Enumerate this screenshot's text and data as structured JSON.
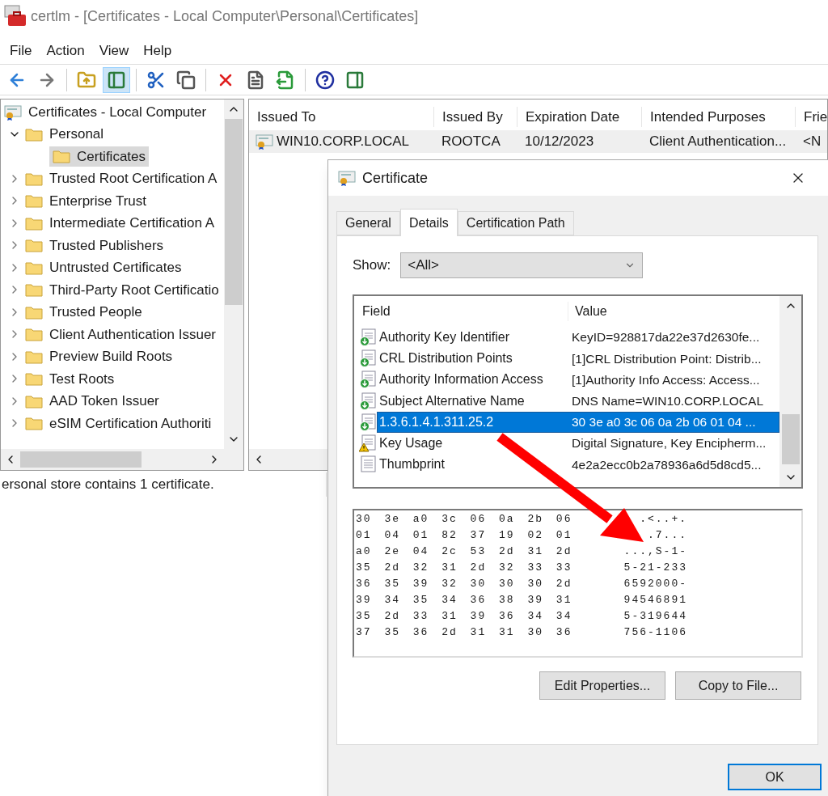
{
  "window": {
    "title": "certlm - [Certificates - Local Computer\\Personal\\Certificates]"
  },
  "menu": [
    "File",
    "Action",
    "View",
    "Help"
  ],
  "toolbar": [
    {
      "kind": "back",
      "selected": false
    },
    {
      "kind": "forward",
      "selected": false
    },
    {
      "kind": "sep"
    },
    {
      "kind": "folder-up",
      "selected": false
    },
    {
      "kind": "tree-pane",
      "selected": true
    },
    {
      "kind": "sep"
    },
    {
      "kind": "cut",
      "selected": false
    },
    {
      "kind": "copy",
      "selected": false
    },
    {
      "kind": "sep"
    },
    {
      "kind": "delete",
      "selected": false
    },
    {
      "kind": "properties",
      "selected": false
    },
    {
      "kind": "export",
      "selected": false
    },
    {
      "kind": "sep"
    },
    {
      "kind": "help",
      "selected": false
    },
    {
      "kind": "action-pane",
      "selected": false
    }
  ],
  "tree": {
    "root": "Certificates - Local Computer",
    "items": [
      {
        "label": "Personal",
        "expanded": true,
        "children": [
          {
            "label": "Certificates",
            "selected": true
          }
        ]
      },
      {
        "label": "Trusted Root Certification A",
        "expanded": false
      },
      {
        "label": "Enterprise Trust",
        "expanded": false
      },
      {
        "label": "Intermediate Certification A",
        "expanded": false
      },
      {
        "label": "Trusted Publishers",
        "expanded": false
      },
      {
        "label": "Untrusted Certificates",
        "expanded": false
      },
      {
        "label": "Third-Party Root Certificatio",
        "expanded": false
      },
      {
        "label": "Trusted People",
        "expanded": false
      },
      {
        "label": "Client Authentication Issuer",
        "expanded": false
      },
      {
        "label": "Preview Build Roots",
        "expanded": false
      },
      {
        "label": "Test Roots",
        "expanded": false
      },
      {
        "label": "AAD Token Issuer",
        "expanded": false
      },
      {
        "label": "eSIM Certification Authoriti",
        "expanded": false
      }
    ]
  },
  "table": {
    "columns": [
      "Issued To",
      "Issued By",
      "Expiration Date",
      "Intended Purposes",
      "Frie"
    ],
    "rows": [
      {
        "selected": true,
        "cells": [
          "WIN10.CORP.LOCAL",
          "ROOTCA",
          "10/12/2023",
          "Client Authentication...",
          "<N"
        ]
      }
    ]
  },
  "status_bar": "ersonal store contains 1 certificate.",
  "dialog": {
    "title": "Certificate",
    "tabs": [
      {
        "label": "General",
        "selected": false
      },
      {
        "label": "Details",
        "selected": true
      },
      {
        "label": "Certification Path",
        "selected": false
      }
    ],
    "show_label": "Show:",
    "show_value": "<All>",
    "field_columns": [
      "Field",
      "Value"
    ],
    "fields": [
      {
        "kind": "extension",
        "field": "Authority Key Identifier",
        "value": "KeyID=928817da22e37d2630fe...",
        "selected": false
      },
      {
        "kind": "extension",
        "field": "CRL Distribution Points",
        "value": "[1]CRL Distribution Point: Distrib...",
        "selected": false
      },
      {
        "kind": "extension",
        "field": "Authority Information Access",
        "value": "[1]Authority Info Access: Access...",
        "selected": false
      },
      {
        "kind": "extension",
        "field": "Subject Alternative Name",
        "value": "DNS Name=WIN10.CORP.LOCAL",
        "selected": false
      },
      {
        "kind": "extension",
        "field": "1.3.6.1.4.1.311.25.2",
        "value": "30 3e a0 3c 06 0a 2b 06 01 04 ...",
        "selected": true
      },
      {
        "kind": "critical",
        "field": "Key Usage",
        "value": "Digital Signature, Key Encipherm...",
        "selected": false
      },
      {
        "kind": "property",
        "field": "Thumbprint",
        "value": "4e2a2ecc0b2a78936a6d5d8cd5...",
        "selected": false
      }
    ],
    "hex_rows": [
      {
        "hex": "30 3e a0 3c 06 0a 2b 06",
        "ascii": ".<..+."
      },
      {
        "hex": "01 04 01 82 37 19 02 01",
        "ascii": ".7..."
      },
      {
        "hex": "a0 2e 04 2c 53 2d 31 2d",
        "ascii": "...,S-1-"
      },
      {
        "hex": "35 2d 32 31 2d 32 33 33",
        "ascii": "5-21-233"
      },
      {
        "hex": "36 35 39 32 30 30 30 2d",
        "ascii": "6592000-"
      },
      {
        "hex": "39 34 35 34 36 38 39 31",
        "ascii": "94546891"
      },
      {
        "hex": "35 2d 33 31 39 36 34 34",
        "ascii": "5-319644"
      },
      {
        "hex": "37 35 36 2d 31 31 30 36",
        "ascii": "756-1106"
      }
    ],
    "buttons": [
      "Edit Properties...",
      "Copy to File..."
    ],
    "ok": "OK"
  }
}
